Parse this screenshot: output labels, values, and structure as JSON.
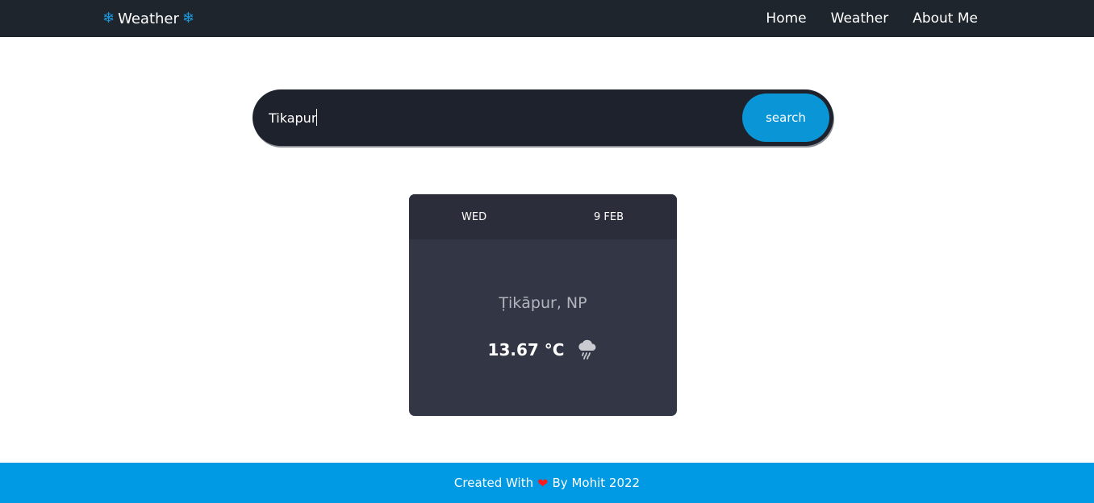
{
  "navbar": {
    "brand_icon": "snowflake-icon",
    "brand_icon_glyph": "❄",
    "brand_label": "Weather",
    "links": [
      {
        "label": "Home"
      },
      {
        "label": "Weather"
      },
      {
        "label": "About Me"
      }
    ]
  },
  "search": {
    "value": "Tikapur",
    "button_label": "search"
  },
  "card": {
    "day": "WED",
    "date": "9 FEB",
    "location": "Ṭikāpur, NP",
    "temperature": "13.67 °C",
    "condition_icon": "rain-cloud-icon"
  },
  "footer": {
    "prefix": "Created With",
    "heart_glyph": "❤",
    "suffix": "By Mohit 2022"
  },
  "colors": {
    "navbar_bg": "#1f252c",
    "accent": "#0099e3",
    "search_bg": "#1e222d",
    "card_bg": "#333645",
    "heart": "#ff1a1a"
  }
}
